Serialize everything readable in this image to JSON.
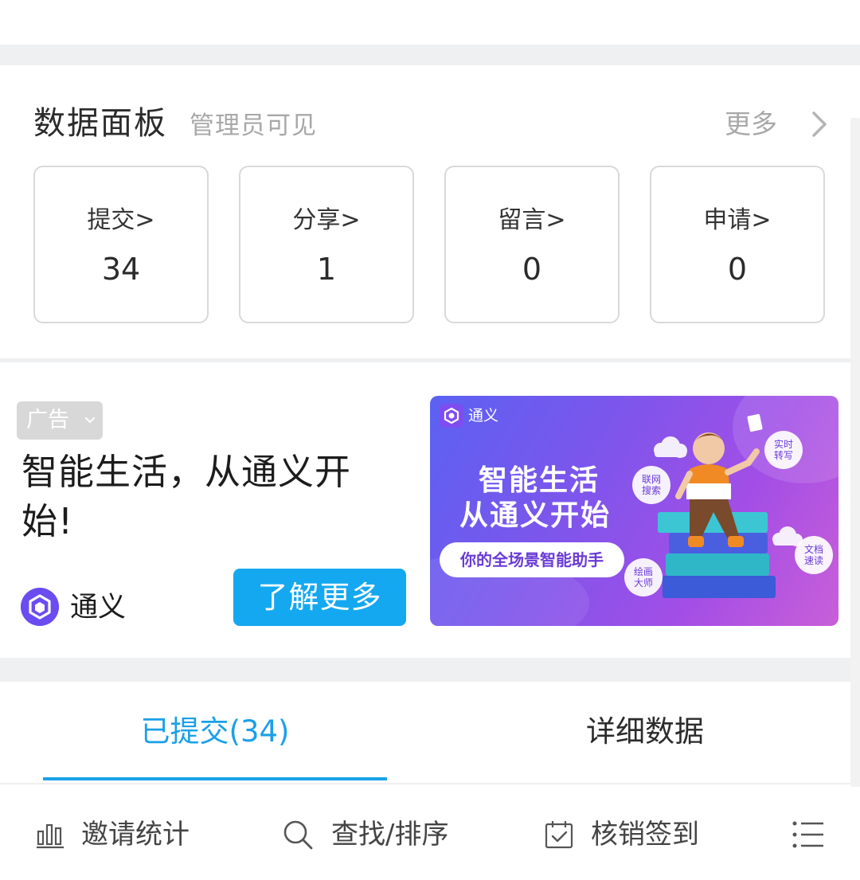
{
  "dashboard": {
    "title": "数据面板",
    "subtitle": "管理员可见",
    "more_label": "更多",
    "stats": [
      {
        "label": "提交>",
        "value": "34"
      },
      {
        "label": "分享>",
        "value": "1"
      },
      {
        "label": "留言>",
        "value": "0"
      },
      {
        "label": "申请>",
        "value": "0"
      }
    ]
  },
  "ad": {
    "tag": "广告",
    "headline": "智能生活，从通义开始!",
    "brand": "通义",
    "cta": "了解更多",
    "banner": {
      "brand": "通义",
      "line1": "智能生活",
      "line2": "从通义开始",
      "pill": "你的全场景智能助手",
      "bubbles": [
        {
          "a": "联网",
          "b": "搜索"
        },
        {
          "a": "实时",
          "b": "转写"
        },
        {
          "a": "文档",
          "b": "速读"
        },
        {
          "a": "绘画",
          "b": "大师"
        }
      ]
    }
  },
  "tabs": [
    {
      "label": "已提交(34)",
      "active": true
    },
    {
      "label": "详细数据",
      "active": false
    }
  ],
  "toolbar": {
    "invite_stats": "邀请统计",
    "search_sort": "查找/排序",
    "checkin": "核销签到"
  },
  "colors": {
    "accent": "#1aa0e8",
    "cta": "#14a8f0",
    "brand_purple": "#6a4cf0"
  }
}
